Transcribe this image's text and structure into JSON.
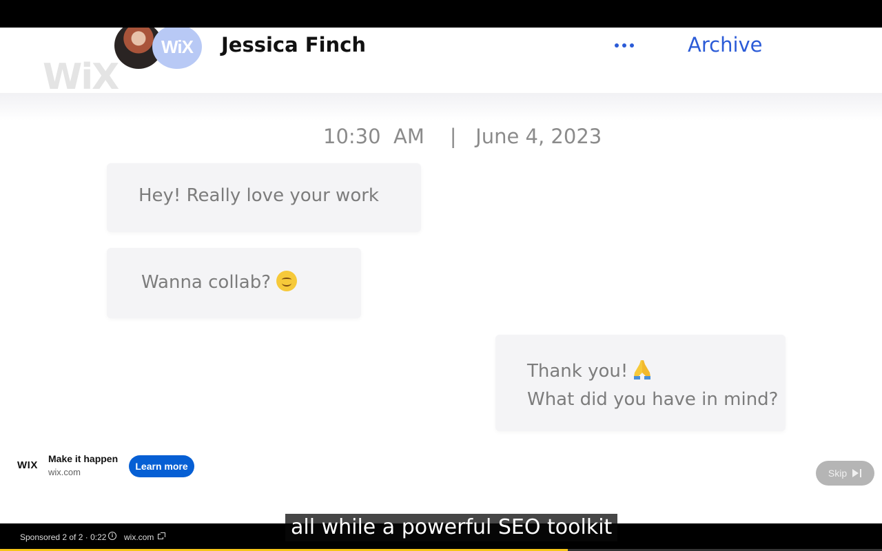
{
  "chat": {
    "contact_name": "Jessica Finch",
    "archive_label": "Archive",
    "avatar_brand": "WiX",
    "watermark": "WiX",
    "timestamp": "10:30  AM    |   June 4, 2023",
    "messages": [
      {
        "direction": "incoming",
        "text": "Hey! Really love your work"
      },
      {
        "direction": "incoming",
        "text": "Wanna collab?",
        "emoji": "smiling-face-icon"
      },
      {
        "direction": "outgoing",
        "line1": "Thank you!",
        "line1_emoji": "folded-hands-icon",
        "line2": "What did you have in mind?"
      }
    ],
    "colors": {
      "accent": "#2b5bd7",
      "bubble": "#f4f4f6",
      "bubble_text": "#7c7c7c"
    }
  },
  "ad": {
    "logo": "WIX",
    "title": "Make it happen",
    "domain": "wix.com",
    "cta_label": "Learn more",
    "skip_label": "Skip",
    "cta_color": "#065fd4"
  },
  "player": {
    "caption": "all while a powerful SEO toolkit",
    "sponsored_text": "Sponsored 2 of 2 · 0:22",
    "bar_domain": "wix.com",
    "progress_fraction": 0.644,
    "progress_color": "#f5c518"
  }
}
